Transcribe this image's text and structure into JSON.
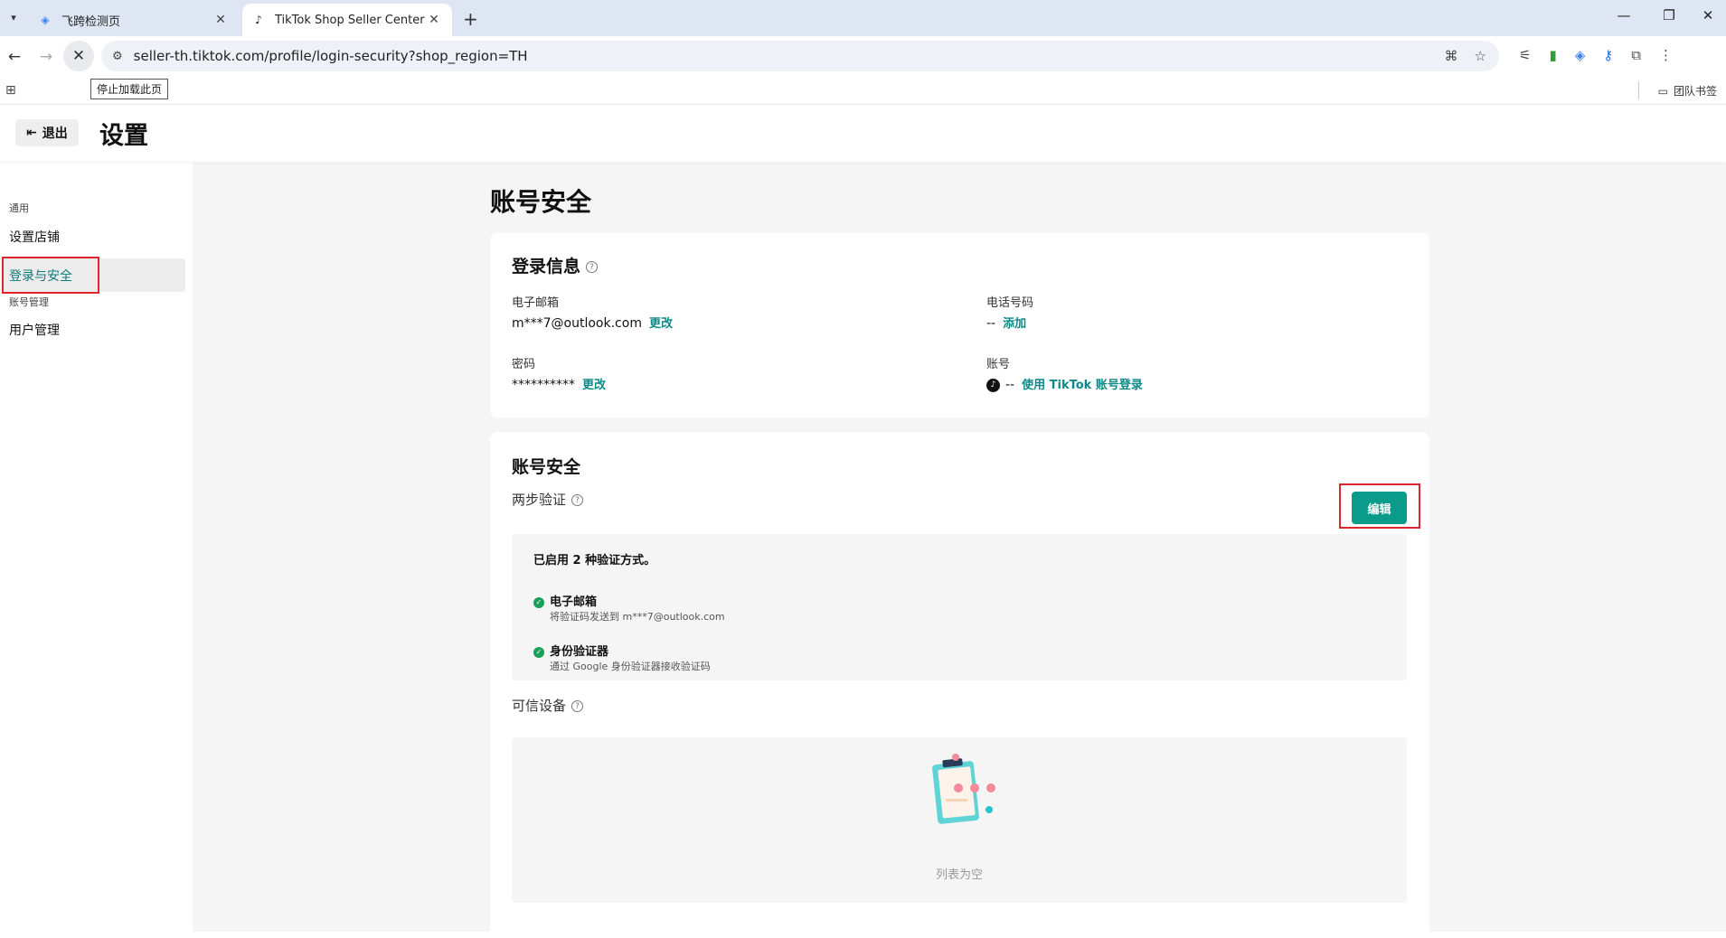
{
  "browser": {
    "tabs": [
      {
        "title": "飞跨检测页",
        "active": false
      },
      {
        "title": "TikTok Shop Seller Center | Th",
        "active": true
      }
    ],
    "url_host": "seller-th.tiktok.com",
    "url_path": "/profile/login-security?shop_region=TH",
    "tooltip": "停止加载此页",
    "bookmark_folder": "团队书签"
  },
  "header": {
    "logout_label": "退出",
    "title": "设置"
  },
  "sidebar": {
    "group1": "通用",
    "item_shop": "设置店铺",
    "item_login": "登录与安全",
    "group2": "账号管理",
    "item_users": "用户管理"
  },
  "main": {
    "heading": "账号安全",
    "login_info": {
      "title": "登录信息",
      "email_label": "电子邮箱",
      "email_value": "m***7@outlook.com",
      "email_action": "更改",
      "phone_label": "电话号码",
      "phone_value": "--",
      "phone_action": "添加",
      "password_label": "密码",
      "password_value": "**********",
      "password_action": "更改",
      "account_label": "账号",
      "account_value": "--",
      "account_action": "使用 TikTok 账号登录"
    },
    "security": {
      "title": "账号安全",
      "two_step_label": "两步验证",
      "edit_label": "编辑",
      "enabled_text": "已启用 2 种验证方式。",
      "methods": [
        {
          "name": "电子邮箱",
          "desc": "将验证码发送到 m***7@outlook.com"
        },
        {
          "name": "身份验证器",
          "desc": "通过 Google 身份验证器接收验证码"
        }
      ],
      "trusted_label": "可信设备",
      "empty_text": "列表为空"
    }
  },
  "colors": {
    "accent": "#0b9b8a",
    "highlight_box": "#e0252f"
  }
}
